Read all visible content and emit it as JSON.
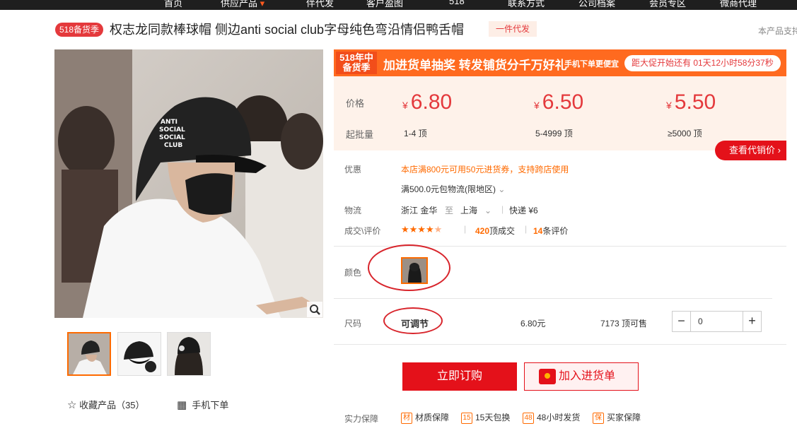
{
  "topnav": [
    "首页",
    "供应产品",
    "伴代发",
    "客户盈图",
    "518",
    "联系方式",
    "公司档案",
    "会员专区",
    "微商代理"
  ],
  "header": {
    "badge": "518备货季",
    "title": "权志龙同款棒球帽 侧边anti social club字母纯色弯沿情侣鸭舌帽",
    "dropship": "一件代发",
    "support": "本产品支持"
  },
  "gallery": {
    "favorite": "收藏产品（35）",
    "mobile_order": "手机下单"
  },
  "promo": {
    "tag_line1": "518年中",
    "tag_line2": "备货季",
    "text": "加进货单抽奖 转发铺货分千万好礼",
    "subtext": "手机下单更便宜",
    "countdown": "距大促开始还有 01天12小时58分37秒"
  },
  "pricing": {
    "price_label": "价格",
    "batch_label": "起批量",
    "currency": "¥",
    "tiers": [
      {
        "price": "6.80",
        "range": "1-4 顶"
      },
      {
        "price": "6.50",
        "range": "5-4999 顶"
      },
      {
        "price": "5.50",
        "range": "≥5000 顶"
      }
    ],
    "proxy_button": "查看代销价 ›"
  },
  "details": {
    "discount_label": "优惠",
    "discount_text": "本店满800元可用50元进货券，支持跨店使用",
    "shipping_free": "满500.0元包物流(限地区)",
    "logistics_label": "物流",
    "origin": "浙江 金华",
    "to": "至",
    "dest": "上海",
    "express": "快递 ¥6",
    "deals_label": "成交\\评价",
    "rating": 4.5,
    "sold_count": "420",
    "sold_suffix": "顶成交",
    "review_count": "14",
    "review_suffix": "条评价"
  },
  "options": {
    "color_label": "颜色",
    "size_label": "尺码",
    "size_value": "可调节",
    "unit_price": "6.80元",
    "stock": "7173 顶可售",
    "quantity": "0"
  },
  "actions": {
    "buy": "立即订购",
    "cart": "加入进货单"
  },
  "guarantee": {
    "label": "实力保障",
    "items": [
      {
        "icon": "材",
        "text": "材质保障"
      },
      {
        "icon": "15",
        "text": "15天包换"
      },
      {
        "icon": "48",
        "text": "48小时发货"
      },
      {
        "icon": "保",
        "text": "买家保障"
      }
    ]
  },
  "colors": {
    "accent": "#e4111a",
    "orange": "#ff6a00",
    "price_bg": "#fef2ea"
  }
}
